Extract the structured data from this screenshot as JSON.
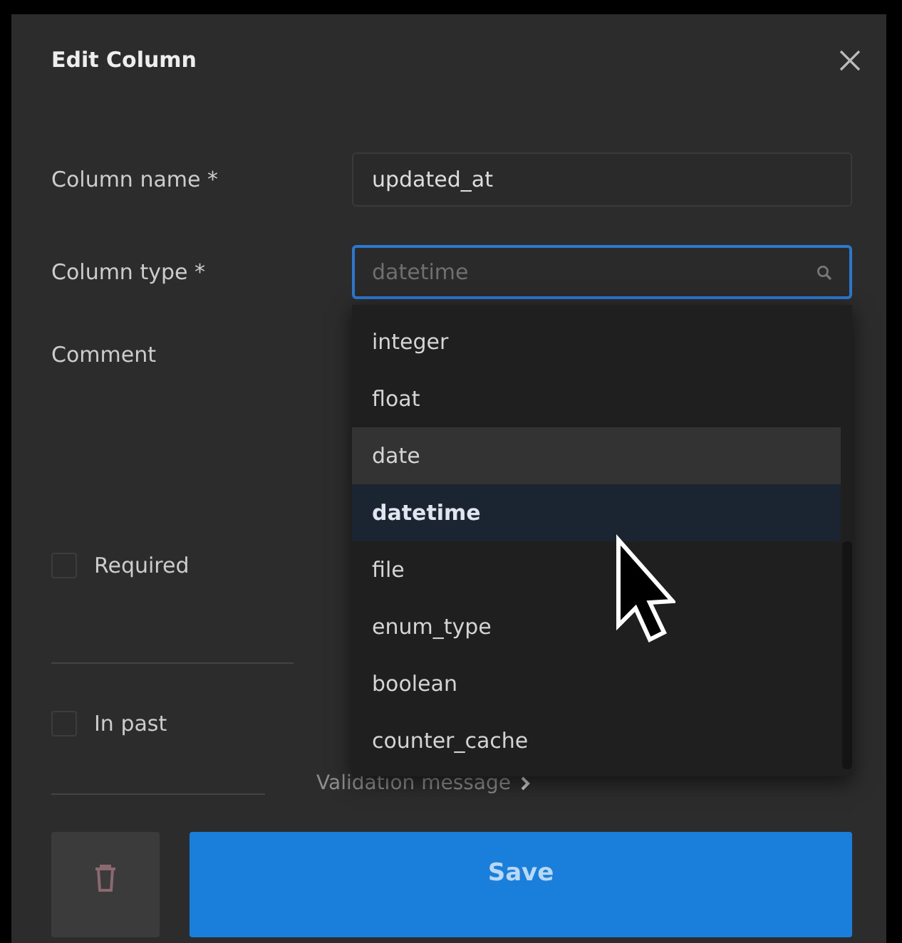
{
  "dialog": {
    "title": "Edit Column",
    "fields": [
      {
        "label": "Column name *",
        "value": "updated_at",
        "focused": false
      },
      {
        "label": "Column type *",
        "placeholder": "datetime",
        "focused": true
      }
    ],
    "comment_label": "Comment",
    "options": [
      {
        "label": "integer",
        "selected": false,
        "hovered": false
      },
      {
        "label": "float",
        "selected": false,
        "hovered": false
      },
      {
        "label": "date",
        "selected": false,
        "hovered": true
      },
      {
        "label": "datetime",
        "selected": true,
        "hovered": false
      },
      {
        "label": "file",
        "selected": false,
        "hovered": false
      },
      {
        "label": "enum_type",
        "selected": false,
        "hovered": false
      },
      {
        "label": "boolean",
        "selected": false,
        "hovered": false
      },
      {
        "label": "counter_cache",
        "selected": false,
        "hovered": false
      }
    ],
    "checkboxes": [
      {
        "label": "Required",
        "checked": false
      },
      {
        "label": "In past",
        "checked": false
      }
    ],
    "validation_link": "Validation message",
    "save_button": "Save"
  }
}
